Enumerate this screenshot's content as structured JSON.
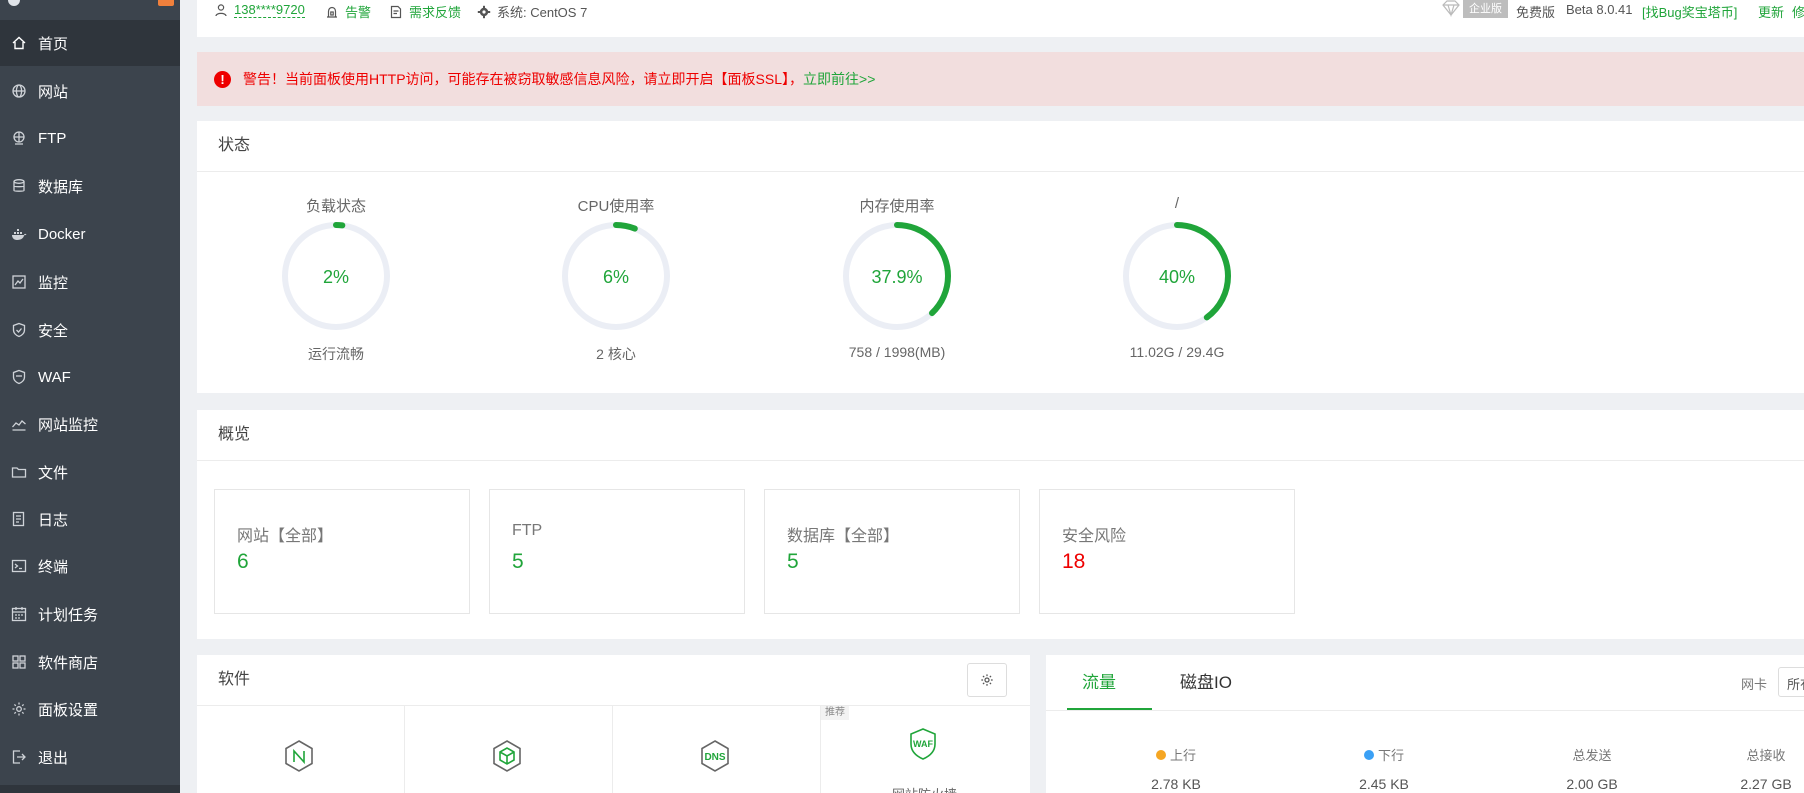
{
  "sidebar": {
    "items": [
      {
        "label": "首页",
        "icon": "home-icon"
      },
      {
        "label": "网站",
        "icon": "globe-icon"
      },
      {
        "label": "FTP",
        "icon": "ftp-globe-icon"
      },
      {
        "label": "数据库",
        "icon": "database-icon"
      },
      {
        "label": "Docker",
        "icon": "docker-icon"
      },
      {
        "label": "监控",
        "icon": "monitor-icon"
      },
      {
        "label": "安全",
        "icon": "shield-icon"
      },
      {
        "label": "WAF",
        "icon": "waf-shield-icon"
      },
      {
        "label": "网站监控",
        "icon": "chart-line-icon"
      },
      {
        "label": "文件",
        "icon": "folder-icon"
      },
      {
        "label": "日志",
        "icon": "log-icon"
      },
      {
        "label": "终端",
        "icon": "terminal-icon"
      },
      {
        "label": "计划任务",
        "icon": "calendar-icon"
      },
      {
        "label": "软件商店",
        "icon": "grid-icon"
      },
      {
        "label": "面板设置",
        "icon": "gear-icon"
      },
      {
        "label": "退出",
        "icon": "logout-icon"
      }
    ]
  },
  "header": {
    "user": "138****9720",
    "alarm": "告警",
    "feedback": "需求反馈",
    "system": "系统: CentOS 7",
    "enterprise": "企业版",
    "free": "免费版",
    "version": "Beta 8.0.41",
    "bug_bounty": "[找Bug奖宝塔币]",
    "update": "更新",
    "repair": "修"
  },
  "alert": {
    "text": "警告！当前面板使用HTTP访问，可能存在被窃取敏感信息风险，请立即开启【面板SSL】，",
    "link": "立即前往>>"
  },
  "status": {
    "title": "状态",
    "gauges": [
      {
        "name": "负载状态",
        "value": "2%",
        "percent": 2,
        "sub": "运行流畅"
      },
      {
        "name": "CPU使用率",
        "value": "6%",
        "percent": 6,
        "sub": "2 核心"
      },
      {
        "name": "内存使用率",
        "value": "37.9%",
        "percent": 37.9,
        "sub": "758 / 1998(MB)"
      },
      {
        "name": "/",
        "value": "40%",
        "percent": 40,
        "sub": "11.02G / 29.4G"
      }
    ]
  },
  "overview": {
    "title": "概览",
    "cards": [
      {
        "label": "网站【全部】",
        "value": "6"
      },
      {
        "label": "FTP",
        "value": "5"
      },
      {
        "label": "数据库【全部】",
        "value": "5"
      },
      {
        "label": "安全风险",
        "value": "18"
      }
    ]
  },
  "software": {
    "title": "软件",
    "recommend": "推荐",
    "waf_caption": "网站防火墙"
  },
  "traffic": {
    "tabs": [
      "流量",
      "磁盘IO"
    ],
    "nic_label": "网卡",
    "nic_value": "所有",
    "stats": [
      {
        "label": "上行",
        "value": "2.78 KB",
        "dot": "#f5a623"
      },
      {
        "label": "下行",
        "value": "2.45 KB",
        "dot": "#3aa0f5"
      },
      {
        "label": "总发送",
        "value": "2.00 GB"
      },
      {
        "label": "总接收",
        "value": "2.27 GB"
      }
    ]
  },
  "colors": {
    "accent": "#20a53a",
    "danger": "#e00000",
    "sidebar": "#3c444d"
  }
}
